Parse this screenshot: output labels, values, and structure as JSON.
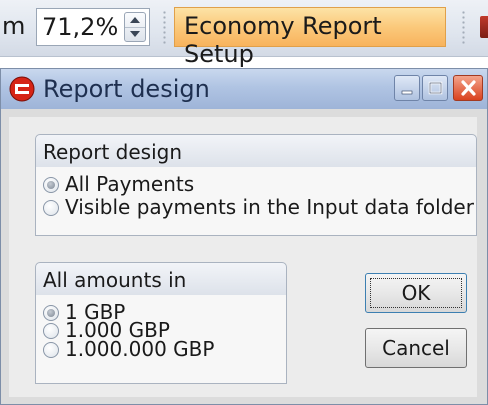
{
  "toolbar": {
    "cutoff_text": "m",
    "zoom_value": "71,2%",
    "report_button_label": "Economy Report Setup"
  },
  "dialog": {
    "title": "Report design",
    "design_group": {
      "title": "Report design",
      "options": [
        "All Payments",
        "Visible payments in the Input data folder"
      ],
      "selected": 0
    },
    "amounts_group": {
      "title": "All amounts in",
      "options": [
        "1 GBP",
        "1.000 GBP",
        "1.000.000 GBP"
      ],
      "selected": 0
    },
    "ok_label": "OK",
    "cancel_label": "Cancel"
  },
  "colors": {
    "report_button": "#fbc97b",
    "titlebar": "#b0c4e3",
    "close_button": "#d9421f"
  }
}
